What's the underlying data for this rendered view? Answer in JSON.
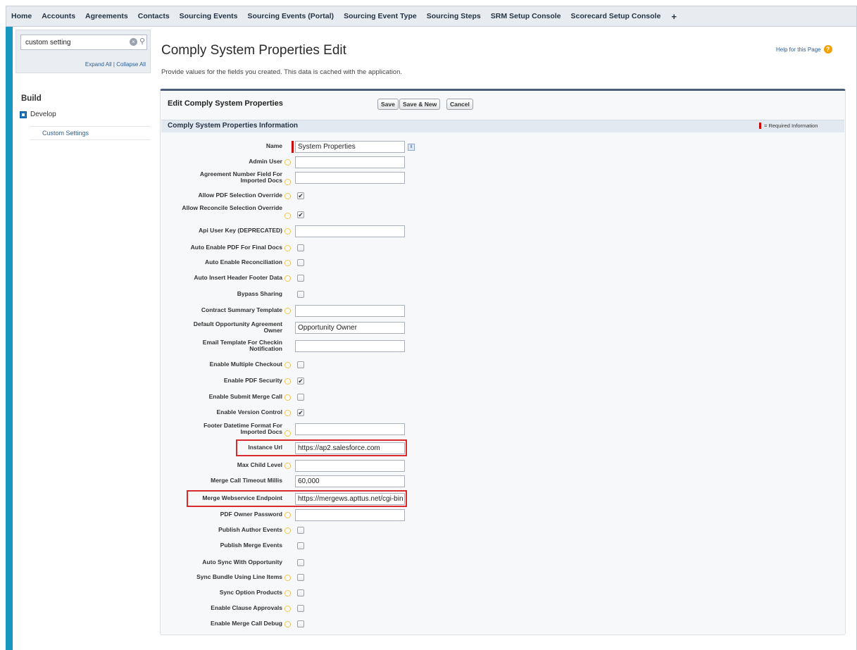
{
  "nav": {
    "tabs": [
      "Home",
      "Accounts",
      "Agreements",
      "Contacts",
      "Sourcing Events",
      "Sourcing Events (Portal)",
      "Sourcing Event Type",
      "Sourcing Steps",
      "SRM Setup Console",
      "Scorecard Setup Console"
    ],
    "plus": "+"
  },
  "sidebar": {
    "search_value": "custom setting",
    "expand_links": "Expand All | Collapse All",
    "build_title": "Build",
    "develop_label": "Develop",
    "custom_settings_label": "Custom Settings"
  },
  "header": {
    "title": "Comply System Properties Edit",
    "description": "Provide values for the fields you created. This data is cached with the application.",
    "help_link": "Help for this Page"
  },
  "edit": {
    "title": "Edit Comply System Properties",
    "save": "Save",
    "save_new": "Save & New",
    "cancel": "Cancel",
    "section_title": "Comply System Properties Information",
    "required_legend": "= Required Information"
  },
  "fields": [
    {
      "label": "Name",
      "type": "text",
      "value": "System Properties",
      "required": true,
      "help": false,
      "info": true
    },
    {
      "label": "Admin User",
      "type": "text",
      "value": "",
      "help": true
    },
    {
      "label": "Agreement Number Field For Imported Docs",
      "type": "text",
      "value": "",
      "help": true
    },
    {
      "label": "Allow PDF Selection Override",
      "type": "checkbox",
      "checked": true,
      "help": true
    },
    {
      "label": "Allow Reconcile Selection Override",
      "type": "checkbox",
      "checked": true,
      "help": true
    },
    {
      "label": "Api User Key (DEPRECATED)",
      "type": "text",
      "value": "",
      "help": true
    },
    {
      "label": "Auto Enable PDF For Final Docs",
      "type": "checkbox",
      "checked": false,
      "help": true
    },
    {
      "label": "Auto Enable Reconciliation",
      "type": "checkbox",
      "checked": false,
      "help": true
    },
    {
      "label": "Auto Insert Header Footer Data",
      "type": "checkbox",
      "checked": false,
      "help": true
    },
    {
      "label": "Bypass Sharing",
      "type": "checkbox",
      "checked": false,
      "help": false
    },
    {
      "label": "Contract Summary Template",
      "type": "text",
      "value": "",
      "help": true
    },
    {
      "label": "Default Opportunity Agreement Owner",
      "type": "text",
      "value": "Opportunity Owner",
      "help": false
    },
    {
      "label": "Email Template For Checkin Notification",
      "type": "text",
      "value": "",
      "help": false
    },
    {
      "label": "Enable Multiple Checkout",
      "type": "checkbox",
      "checked": false,
      "help": true
    },
    {
      "label": "Enable PDF Security",
      "type": "checkbox",
      "checked": true,
      "help": true
    },
    {
      "label": "Enable Submit Merge Call",
      "type": "checkbox",
      "checked": false,
      "help": true
    },
    {
      "label": "Enable Version Control",
      "type": "checkbox",
      "checked": true,
      "help": true
    },
    {
      "label": "Footer Datetime Format For Imported Docs",
      "type": "text",
      "value": "",
      "help": true
    },
    {
      "label": "Instance Url",
      "type": "text",
      "value": "https://ap2.salesforce.com",
      "help": false,
      "highlighted": true
    },
    {
      "label": "Max Child Level",
      "type": "text",
      "value": "",
      "help": true
    },
    {
      "label": "Merge Call Timeout Millis",
      "type": "text",
      "value": "60,000",
      "help": false
    },
    {
      "label": "Merge Webservice Endpoint",
      "type": "text",
      "value": "https://mergews.apttus.net/cgi-bin",
      "help": false,
      "highlighted": true
    },
    {
      "label": "PDF Owner Password",
      "type": "text",
      "value": "",
      "help": true
    },
    {
      "label": "Publish Author Events",
      "type": "checkbox",
      "checked": false,
      "help": true
    },
    {
      "label": "Publish Merge Events",
      "type": "checkbox",
      "checked": false,
      "help": false
    },
    {
      "label": "Auto Sync With Opportunity",
      "type": "checkbox",
      "checked": false,
      "help": false
    },
    {
      "label": "Sync Bundle Using Line Items",
      "type": "checkbox",
      "checked": false,
      "help": true
    },
    {
      "label": "Sync Option Products",
      "type": "checkbox",
      "checked": false,
      "help": true
    },
    {
      "label": "Enable Clause Approvals",
      "type": "checkbox",
      "checked": false,
      "help": true
    },
    {
      "label": "Enable Merge Call Debug",
      "type": "checkbox",
      "checked": false,
      "help": true
    }
  ],
  "colors": {
    "accent": "#1797c0",
    "required": "#cc0000",
    "highlight_box": "#d92b2b",
    "panel_border": "#4c5f7a"
  },
  "icons": {
    "search": "search-icon",
    "clear": "clear-icon",
    "help": "help-icon",
    "field_help": "help-bubble-icon",
    "info": "info-icon"
  }
}
